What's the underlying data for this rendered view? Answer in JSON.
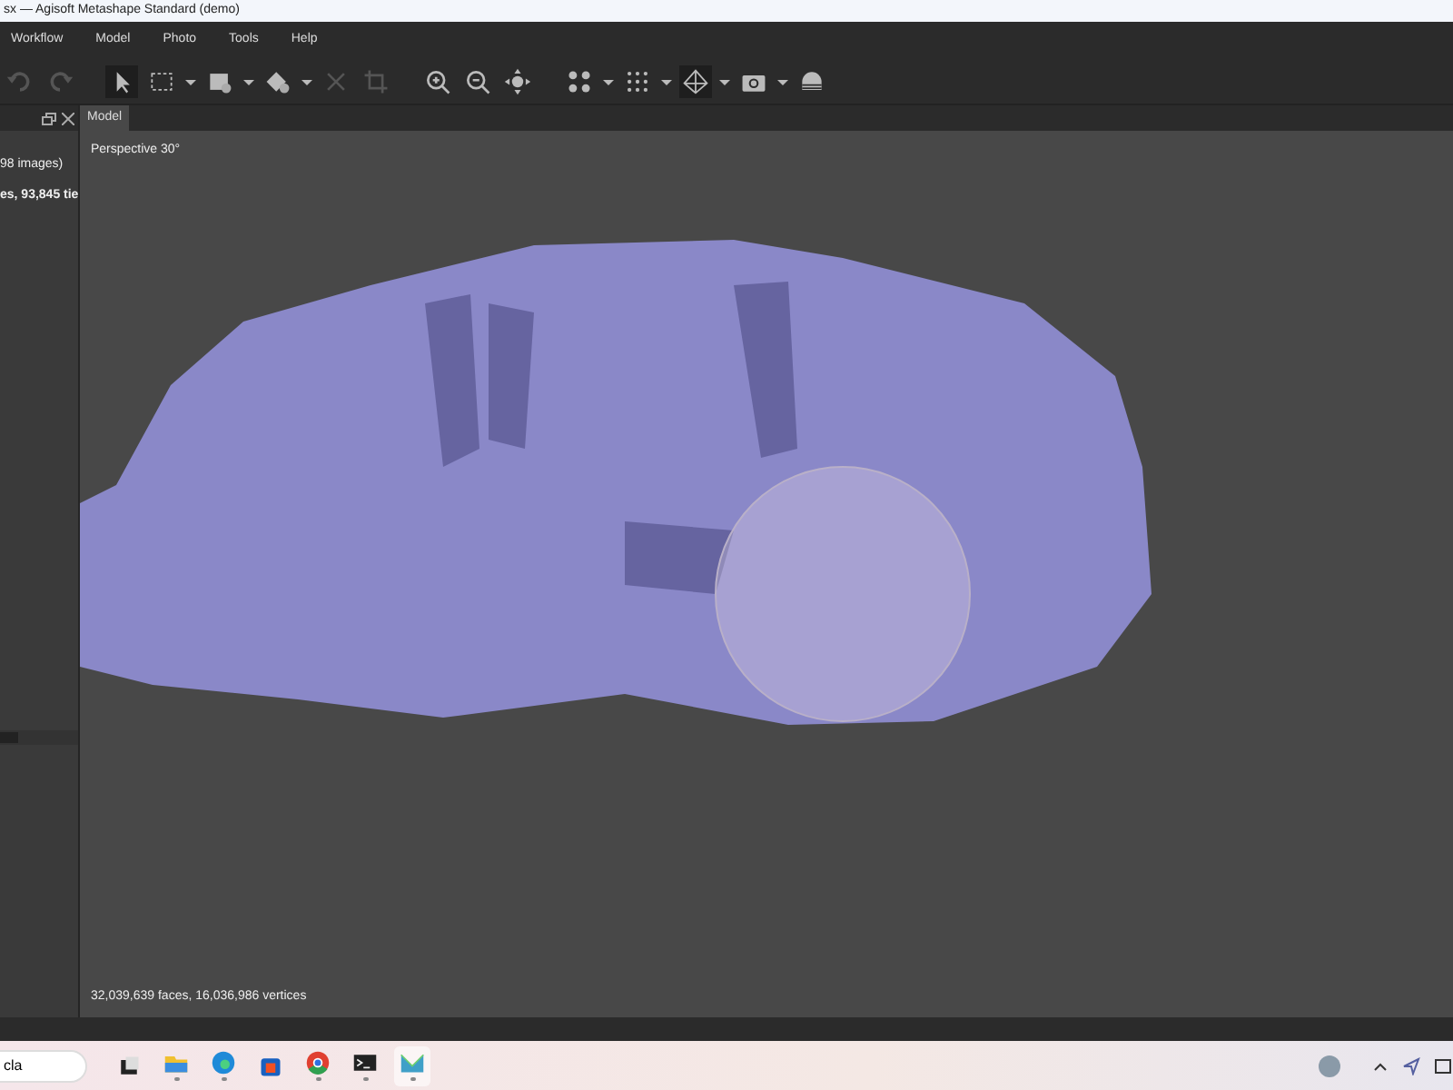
{
  "window": {
    "title": "sx — Agisoft Metashape Standard (demo)"
  },
  "menu": [
    "Workflow",
    "Model",
    "Photo",
    "Tools",
    "Help"
  ],
  "toolbar": [
    {
      "kind": "undo",
      "disabled": true
    },
    {
      "kind": "redo",
      "disabled": true
    },
    {
      "kind": "sep"
    },
    {
      "kind": "pointer",
      "disabled": false,
      "selected": true
    },
    {
      "kind": "rect-select",
      "disabled": false,
      "selected": false,
      "dropdown": true
    },
    {
      "kind": "shape",
      "disabled": false,
      "selected": false,
      "dropdown": true
    },
    {
      "kind": "shape2",
      "disabled": false,
      "selected": false,
      "dropdown": true
    },
    {
      "kind": "delete",
      "disabled": true
    },
    {
      "kind": "crop",
      "disabled": true
    },
    {
      "kind": "sep"
    },
    {
      "kind": "zoom-in",
      "disabled": false
    },
    {
      "kind": "zoom-out",
      "disabled": false
    },
    {
      "kind": "move",
      "disabled": false
    },
    {
      "kind": "sep"
    },
    {
      "kind": "dots4",
      "disabled": false,
      "dropdown": true
    },
    {
      "kind": "dots9",
      "disabled": false,
      "dropdown": true
    },
    {
      "kind": "diamond",
      "disabled": false,
      "selected": true,
      "dropdown": true
    },
    {
      "kind": "camera",
      "disabled": false,
      "dropdown": true
    },
    {
      "kind": "stack",
      "disabled": false
    }
  ],
  "workspace": {
    "lines": [
      "98 images)",
      "es, 93,845 tie"
    ]
  },
  "viewport": {
    "tab": {
      "label": "Model",
      "selected": true
    },
    "projection": "Perspective 30°",
    "stats": "32,039,639 faces, 16,036,986 vertices"
  },
  "taskbar": {
    "search": {
      "value": "cla"
    },
    "apps": [
      {
        "kind": "desktop",
        "running": false
      },
      {
        "kind": "folder",
        "running": true
      },
      {
        "kind": "edge",
        "running": true
      },
      {
        "kind": "store",
        "running": false
      },
      {
        "kind": "chrome",
        "running": true
      },
      {
        "kind": "terminal",
        "running": true
      },
      {
        "kind": "metashape",
        "running": true
      }
    ]
  }
}
